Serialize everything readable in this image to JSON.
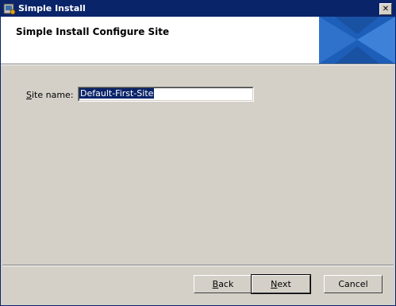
{
  "window": {
    "title": "Simple Install",
    "close_glyph": "✕"
  },
  "banner": {
    "heading": "Simple Install Configure Site",
    "graphic_colors": [
      "#1b5bb5",
      "#3a7fd6",
      "#1a4f9e"
    ]
  },
  "form": {
    "site_label_accel": "S",
    "site_label_rest": "ite name:",
    "site_value": "Default-First-Site"
  },
  "buttons": {
    "back_accel": "B",
    "back_rest": "ack",
    "next_accel": "N",
    "next_rest": "ext",
    "cancel": "Cancel"
  }
}
